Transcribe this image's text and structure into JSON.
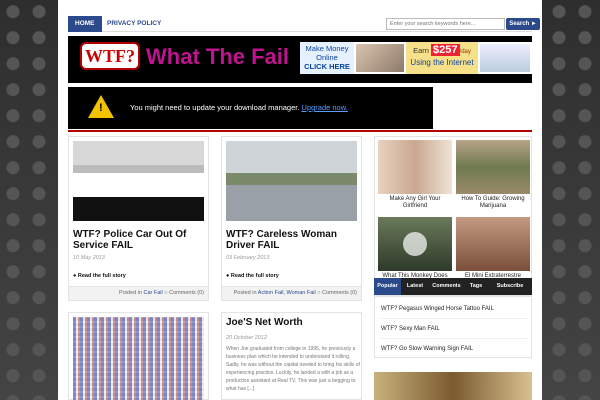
{
  "nav": {
    "items": [
      {
        "label": "HOME",
        "active": true
      },
      {
        "label": "PRIVACY POLICY",
        "active": false
      }
    ],
    "search_placeholder": "Enter your search keywords here...",
    "search_button": "Search ►"
  },
  "header": {
    "logo_text": "WTF?",
    "site_title": "What The Fail",
    "ad": {
      "left_line1": "Make Money",
      "left_line2": "Online",
      "left_line3": "CLICK HERE",
      "earn_prefix": "Earn",
      "earn_amount": "$257",
      "earn_suffix": "/day",
      "using": "Using the Internet"
    }
  },
  "alert": {
    "text": "You might need to update your download manager.",
    "link": "Upgrade now."
  },
  "posts": [
    {
      "title": "WTF? Police Car Out Of Service FAIL",
      "date": "10 May 2013",
      "read_more": "Read the full story",
      "posted_in": "Posted in",
      "categories": "Car Fail",
      "comments": "Comments (0)"
    },
    {
      "title": "WTF? Careless Woman Driver FAIL",
      "date": "03 February 2013",
      "read_more": "Read the full story",
      "posted_in": "Posted in",
      "categories": "Action Fail, Woman Fail",
      "comments": "Comments (0)"
    },
    {
      "title": "Joe'S Net Worth",
      "date": "20 October 2012",
      "excerpt": "When Joe graduated from college in 1995, he previously a business plan which he intended to understand it rolling. Sadly, he was without the capital needed to bring his skills of experiencing practice. Luckily, he landed a with a job as a production assistant at Real TV. This was just a begging to what has [...]"
    }
  ],
  "sidebar": {
    "items": [
      {
        "caption": "Make Any Girl Your Girlfriend"
      },
      {
        "caption": "How To Guide: Growing Marijuana"
      },
      {
        "caption": "What This Monkey Does You Will Shock"
      },
      {
        "caption": "El Mini Extraterrestre Hallado En Chi..."
      }
    ],
    "tabs": [
      "Popular",
      "Latest",
      "Comments",
      "Tags",
      "Subscribe"
    ],
    "tab_items": [
      "WTF? Pegasus Winged Horse Tattoo FAIL",
      "WTF? Sexy Man FAIL",
      "WTF? Go Slow Warning Sign FAIL"
    ]
  },
  "colors": {
    "accent": "#2b4a8b",
    "header_bg": "#000000",
    "title": "#c0138f",
    "rule": "#b50000"
  }
}
